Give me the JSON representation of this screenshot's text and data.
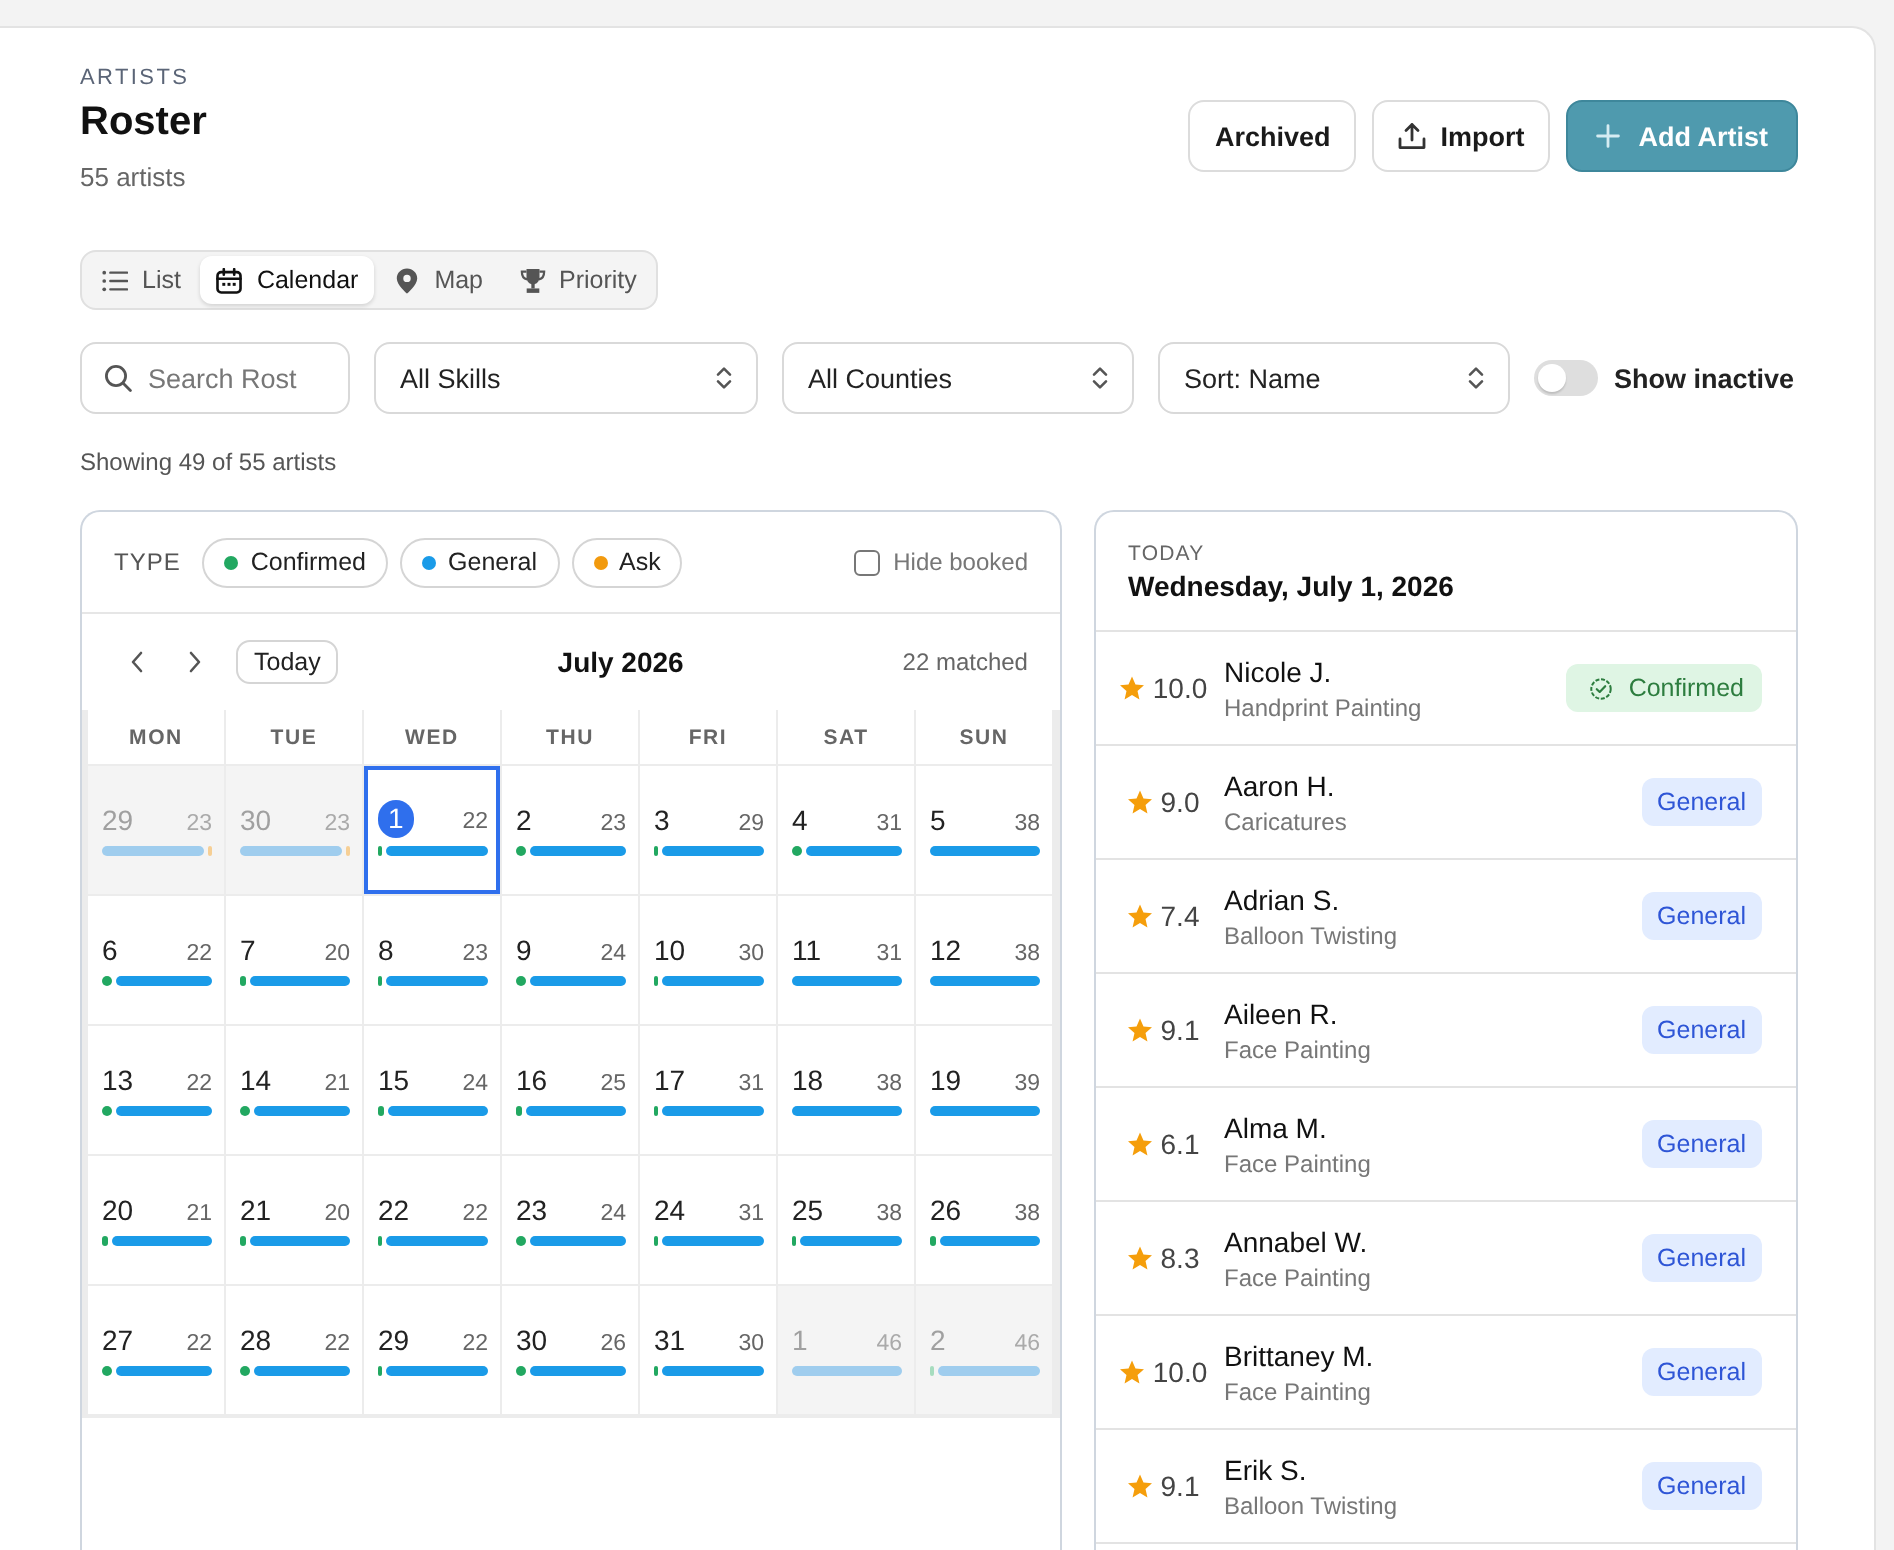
{
  "header": {
    "eyebrow": "ARTISTS",
    "title": "Roster",
    "subtitle": "55 artists"
  },
  "actions": [
    {
      "label": "Archived",
      "kind": "plain"
    },
    {
      "label": "Import",
      "kind": "upload"
    },
    {
      "label": "Add Artist",
      "kind": "add"
    }
  ],
  "view_tabs": [
    {
      "label": "List",
      "selected": false
    },
    {
      "label": "Calendar",
      "selected": true
    },
    {
      "label": "Map",
      "selected": false
    },
    {
      "label": "Priority",
      "selected": false
    }
  ],
  "filters": {
    "search": {
      "placeholder": "Search Rost"
    },
    "selects": [
      {
        "value": "All Skills"
      },
      {
        "value": "All Counties"
      },
      {
        "value": "Sort: Name"
      }
    ],
    "toggle": {
      "label": "Show inactive",
      "on": false
    }
  },
  "result_count": "Showing 49 of 55 artists",
  "calendar": {
    "type_label": "TYPE",
    "legend": [
      {
        "label": "Confirmed",
        "color": "#22a861"
      },
      {
        "label": "General",
        "color": "#1a9be8"
      },
      {
        "label": "Ask",
        "color": "#f29a0e"
      }
    ],
    "hide_booked": {
      "label": "Hide booked",
      "checked": false
    },
    "today_button": "Today",
    "month": "July 2026",
    "matched": "22 matched",
    "weekdays": [
      "MON",
      "TUE",
      "WED",
      "THU",
      "FRI",
      "SAT",
      "SUN"
    ],
    "weeks": [
      {
        "days": [
          {
            "day": "29",
            "count": "23",
            "outside": true,
            "today": false,
            "bars": [
              {
                "kind": "general"
              },
              {
                "kind": "ask"
              }
            ]
          },
          {
            "day": "30",
            "count": "23",
            "outside": true,
            "today": false,
            "bars": [
              {
                "kind": "general"
              },
              {
                "kind": "ask"
              }
            ]
          },
          {
            "day": "1",
            "count": "22",
            "outside": false,
            "today": true,
            "bars": [
              {
                "kind": "line"
              },
              {
                "kind": "general"
              }
            ]
          },
          {
            "day": "2",
            "count": "23",
            "outside": false,
            "today": false,
            "bars": [
              {
                "kind": "dot"
              },
              {
                "kind": "general"
              }
            ]
          },
          {
            "day": "3",
            "count": "29",
            "outside": false,
            "today": false,
            "bars": [
              {
                "kind": "line"
              },
              {
                "kind": "general"
              }
            ]
          },
          {
            "day": "4",
            "count": "31",
            "outside": false,
            "today": false,
            "bars": [
              {
                "kind": "dot"
              },
              {
                "kind": "general"
              }
            ]
          },
          {
            "day": "5",
            "count": "38",
            "outside": false,
            "today": false,
            "bars": [
              {
                "kind": "general"
              }
            ]
          }
        ]
      },
      {
        "days": [
          {
            "day": "6",
            "count": "22",
            "outside": false,
            "today": false,
            "bars": [
              {
                "kind": "dot"
              },
              {
                "kind": "general"
              }
            ]
          },
          {
            "day": "7",
            "count": "20",
            "outside": false,
            "today": false,
            "bars": [
              {
                "kind": "tick"
              },
              {
                "kind": "general"
              }
            ]
          },
          {
            "day": "8",
            "count": "23",
            "outside": false,
            "today": false,
            "bars": [
              {
                "kind": "line"
              },
              {
                "kind": "general"
              }
            ]
          },
          {
            "day": "9",
            "count": "24",
            "outside": false,
            "today": false,
            "bars": [
              {
                "kind": "dot"
              },
              {
                "kind": "general"
              }
            ]
          },
          {
            "day": "10",
            "count": "30",
            "outside": false,
            "today": false,
            "bars": [
              {
                "kind": "line"
              },
              {
                "kind": "general"
              }
            ]
          },
          {
            "day": "11",
            "count": "31",
            "outside": false,
            "today": false,
            "bars": [
              {
                "kind": "general"
              }
            ]
          },
          {
            "day": "12",
            "count": "38",
            "outside": false,
            "today": false,
            "bars": [
              {
                "kind": "general"
              }
            ]
          }
        ]
      },
      {
        "days": [
          {
            "day": "13",
            "count": "22",
            "outside": false,
            "today": false,
            "bars": [
              {
                "kind": "dot"
              },
              {
                "kind": "general"
              }
            ]
          },
          {
            "day": "14",
            "count": "21",
            "outside": false,
            "today": false,
            "bars": [
              {
                "kind": "dot"
              },
              {
                "kind": "general"
              }
            ]
          },
          {
            "day": "15",
            "count": "24",
            "outside": false,
            "today": false,
            "bars": [
              {
                "kind": "tick"
              },
              {
                "kind": "general"
              }
            ]
          },
          {
            "day": "16",
            "count": "25",
            "outside": false,
            "today": false,
            "bars": [
              {
                "kind": "tick"
              },
              {
                "kind": "general"
              }
            ]
          },
          {
            "day": "17",
            "count": "31",
            "outside": false,
            "today": false,
            "bars": [
              {
                "kind": "line"
              },
              {
                "kind": "general"
              }
            ]
          },
          {
            "day": "18",
            "count": "38",
            "outside": false,
            "today": false,
            "bars": [
              {
                "kind": "general"
              }
            ]
          },
          {
            "day": "19",
            "count": "39",
            "outside": false,
            "today": false,
            "bars": [
              {
                "kind": "general"
              }
            ]
          }
        ]
      },
      {
        "days": [
          {
            "day": "20",
            "count": "21",
            "outside": false,
            "today": false,
            "bars": [
              {
                "kind": "tick"
              },
              {
                "kind": "general"
              }
            ]
          },
          {
            "day": "21",
            "count": "20",
            "outside": false,
            "today": false,
            "bars": [
              {
                "kind": "tick"
              },
              {
                "kind": "general"
              }
            ]
          },
          {
            "day": "22",
            "count": "22",
            "outside": false,
            "today": false,
            "bars": [
              {
                "kind": "line"
              },
              {
                "kind": "general"
              }
            ]
          },
          {
            "day": "23",
            "count": "24",
            "outside": false,
            "today": false,
            "bars": [
              {
                "kind": "dot"
              },
              {
                "kind": "general"
              }
            ]
          },
          {
            "day": "24",
            "count": "31",
            "outside": false,
            "today": false,
            "bars": [
              {
                "kind": "line"
              },
              {
                "kind": "general"
              }
            ]
          },
          {
            "day": "25",
            "count": "38",
            "outside": false,
            "today": false,
            "bars": [
              {
                "kind": "line"
              },
              {
                "kind": "general"
              }
            ]
          },
          {
            "day": "26",
            "count": "38",
            "outside": false,
            "today": false,
            "bars": [
              {
                "kind": "tick"
              },
              {
                "kind": "general"
              }
            ]
          }
        ]
      },
      {
        "days": [
          {
            "day": "27",
            "count": "22",
            "outside": false,
            "today": false,
            "bars": [
              {
                "kind": "dot"
              },
              {
                "kind": "general"
              }
            ]
          },
          {
            "day": "28",
            "count": "22",
            "outside": false,
            "today": false,
            "bars": [
              {
                "kind": "dot"
              },
              {
                "kind": "general"
              }
            ]
          },
          {
            "day": "29",
            "count": "22",
            "outside": false,
            "today": false,
            "bars": [
              {
                "kind": "line"
              },
              {
                "kind": "general"
              }
            ]
          },
          {
            "day": "30",
            "count": "26",
            "outside": false,
            "today": false,
            "bars": [
              {
                "kind": "dot"
              },
              {
                "kind": "general"
              }
            ]
          },
          {
            "day": "31",
            "count": "30",
            "outside": false,
            "today": false,
            "bars": [
              {
                "kind": "line"
              },
              {
                "kind": "general"
              }
            ]
          },
          {
            "day": "1",
            "count": "46",
            "outside": true,
            "today": false,
            "bars": [
              {
                "kind": "general"
              }
            ]
          },
          {
            "day": "2",
            "count": "46",
            "outside": true,
            "today": false,
            "bars": [
              {
                "kind": "line"
              },
              {
                "kind": "general"
              }
            ]
          }
        ]
      }
    ]
  },
  "today_panel": {
    "eyebrow": "TODAY",
    "date": "Wednesday, July 1, 2026",
    "artists": [
      {
        "score": "10.0",
        "name": "Nicole J.",
        "skill": "Handprint Painting",
        "status": {
          "kind": "confirmed",
          "label": "Confirmed"
        }
      },
      {
        "score": "9.0",
        "name": "Aaron H.",
        "skill": "Caricatures",
        "status": {
          "kind": "general",
          "label": "General"
        }
      },
      {
        "score": "7.4",
        "name": "Adrian S.",
        "skill": "Balloon Twisting",
        "status": {
          "kind": "general",
          "label": "General"
        }
      },
      {
        "score": "9.1",
        "name": "Aileen R.",
        "skill": "Face Painting",
        "status": {
          "kind": "general",
          "label": "General"
        }
      },
      {
        "score": "6.1",
        "name": "Alma M.",
        "skill": "Face Painting",
        "status": {
          "kind": "general",
          "label": "General"
        }
      },
      {
        "score": "8.3",
        "name": "Annabel W.",
        "skill": "Face Painting",
        "status": {
          "kind": "general",
          "label": "General"
        }
      },
      {
        "score": "10.0",
        "name": "Brittaney M.",
        "skill": "Face Painting",
        "status": {
          "kind": "general",
          "label": "General"
        }
      },
      {
        "score": "9.1",
        "name": "Erik S.",
        "skill": "Balloon Twisting",
        "status": {
          "kind": "general",
          "label": "General"
        }
      }
    ]
  }
}
